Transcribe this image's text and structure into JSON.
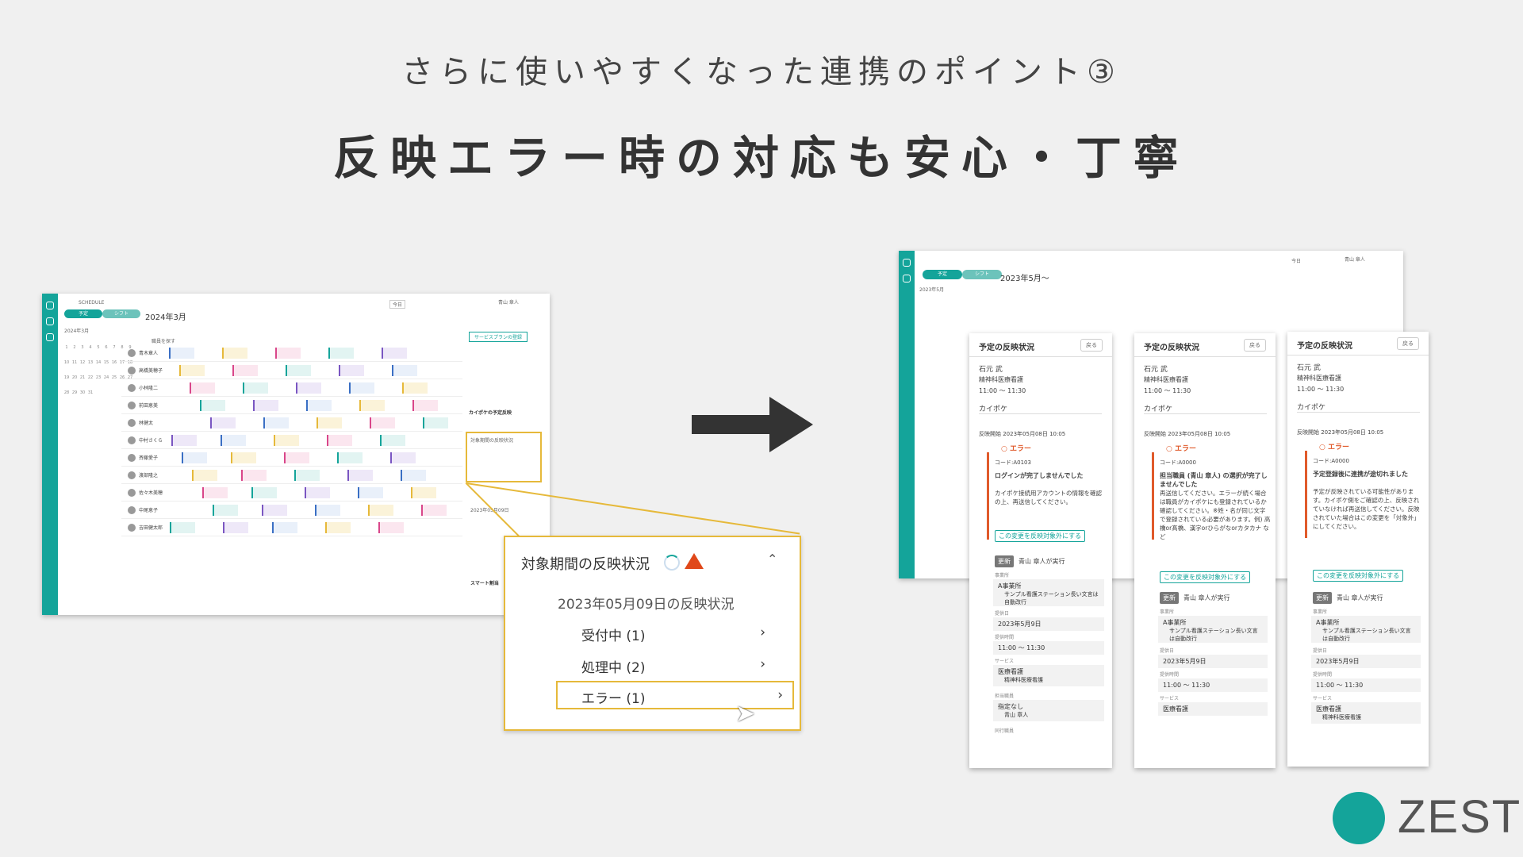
{
  "subtitle": "さらに使いやすくなった連携のポイント③",
  "title": "反映エラー時の対応も安心・丁寧",
  "left_app": {
    "brand": "SCHEDULE",
    "tab_plan": "予定",
    "tab_shift": "シフト",
    "month": "2024年3月",
    "mini_month": "2024年3月",
    "today": "今日",
    "service_btn": "サービスプランの登録",
    "user": "青山 章人",
    "staff_search": "職員を探す",
    "staff": [
      "青木章人",
      "高橋美穂子",
      "小林隆二",
      "前田恵美",
      "林健太",
      "中村さくら",
      "斉藤愛子",
      "渡部隆之",
      "佐々木美穂",
      "中尾恵子",
      "吉田健太郎"
    ],
    "panel_labels": [
      "カイポケの予定反映",
      "対象期間の反映状況",
      "2023年05月09日",
      "スマート割当"
    ]
  },
  "zoom": {
    "header": "対象期間の反映状況",
    "date_status": "2023年05月09日の反映状況",
    "items": [
      "受付中 (1)",
      "処理中 (2)",
      "エラー (1)"
    ]
  },
  "right_app": {
    "month": "2023年5月〜",
    "today": "今日",
    "user": "青山 章人",
    "tab_plan": "予定",
    "tab_shift": "シフト",
    "mini_month": "2023年5月"
  },
  "panels": [
    {
      "title": "予定の反映状況",
      "back": "戻る",
      "name": "石元 武",
      "service": "精神科医療看護",
      "time": "11:00 〜 11:30",
      "dest": "カイポケ",
      "started": "反映開始 2023年05月08日 10:05",
      "status": "エラー",
      "code": "コード:A0103",
      "msg": "ログインが完了しませんでした",
      "detail": "カイポケ接続用アカウントの情報を確認の上、再送信してください。",
      "action": "この変更を反映対象外にする",
      "upd_label": "更新",
      "upd_by": "青山 章人が実行",
      "office_label": "事業所",
      "office": "A事業所",
      "office_sub": "サンプル看護ステーション長い文言は自動改行",
      "date_label": "提供日",
      "date": "2023年5月9日",
      "ptime_label": "提供時間",
      "ptime": "11:00 〜 11:30",
      "svc_label": "サービス",
      "svc": "医療看護",
      "svc_sub": "精神科医療看護",
      "staff_label": "担当職員",
      "staff": "指定なし",
      "staff_sub": "青山 章人",
      "extra": "同行職員"
    },
    {
      "title": "予定の反映状況",
      "back": "戻る",
      "name": "石元 武",
      "service": "精神科医療看護",
      "time": "11:00 〜 11:30",
      "dest": "カイポケ",
      "started": "反映開始 2023年05月08日 10:05",
      "status": "エラー",
      "code": "コード:A0000",
      "msg": "担当職員 (青山 章人) の選択が完了しませんでした",
      "detail": "再送信してください。エラーが続く場合は職員がカイポケにも登録されているか確認してください。※姓・名が同じ文字で登録されている必要があります。例) 高橋or髙橋、漢字orひらがなorカタカナ など",
      "action": "この変更を反映対象外にする",
      "upd_label": "更新",
      "upd_by": "青山 章人が実行",
      "office_label": "事業所",
      "office": "A事業所",
      "office_sub": "サンプル看護ステーション長い文言は自動改行",
      "date_label": "提供日",
      "date": "2023年5月9日",
      "ptime_label": "提供時間",
      "ptime": "11:00 〜 11:30",
      "svc_label": "サービス",
      "svc": "医療看護",
      "svc_sub": "",
      "staff_label": "",
      "staff": "",
      "staff_sub": "",
      "extra": ""
    },
    {
      "title": "予定の反映状況",
      "back": "戻る",
      "name": "石元 武",
      "service": "精神科医療看護",
      "time": "11:00 〜 11:30",
      "dest": "カイポケ",
      "started": "反映開始 2023年05月08日 10:05",
      "status": "エラー",
      "code": "コード:A0000",
      "msg": "予定登録後に連携が途切れました",
      "detail": "予定が反映されている可能性があります。カイポケ側をご確認の上、反映されていなければ再送信してください。反映されていた場合はこの変更を「対象外」にしてください。",
      "action": "この変更を反映対象外にする",
      "upd_label": "更新",
      "upd_by": "青山 章人が実行",
      "office_label": "事業所",
      "office": "A事業所",
      "office_sub": "サンプル看護ステーション長い文言は自動改行",
      "date_label": "提供日",
      "date": "2023年5月9日",
      "ptime_label": "提供時間",
      "ptime": "11:00 〜 11:30",
      "svc_label": "サービス",
      "svc": "医療看護",
      "svc_sub": "精神科医療看護",
      "staff_label": "",
      "staff": "",
      "staff_sub": "",
      "extra": ""
    }
  ],
  "logo": "ZEST"
}
